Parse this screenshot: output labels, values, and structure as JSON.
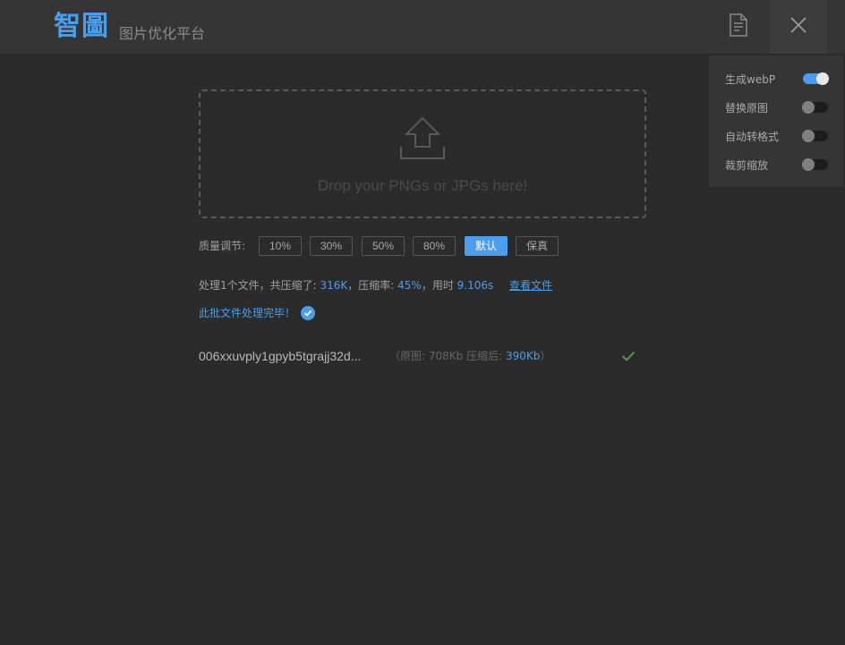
{
  "header": {
    "logo": "智圖",
    "subtitle": "图片优化平台",
    "doc_icon": "document-icon",
    "close_icon": "close-icon"
  },
  "settings": [
    {
      "label": "生成webP",
      "on": true
    },
    {
      "label": "替换原图",
      "on": false
    },
    {
      "label": "自动转格式",
      "on": false
    },
    {
      "label": "裁剪缩放",
      "on": false
    }
  ],
  "dropzone": {
    "icon": "upload-icon",
    "text": "Drop your PNGs or JPGs here!"
  },
  "quality": {
    "label": "质量调节:",
    "options": [
      "10%",
      "30%",
      "50%",
      "80%",
      "默认",
      "保真"
    ],
    "selected": "默认"
  },
  "summary": {
    "prefix": "处理1个文件，共压缩了: ",
    "saved": "316K",
    "ratio_label": "，压缩率: ",
    "ratio": "45%",
    "time_label": "，用时 ",
    "time": "9.106s",
    "view_files": "查看文件"
  },
  "done_message": "此批文件处理完毕！",
  "files": [
    {
      "name": "006xxuvply1gpyb5tgrajj32d...",
      "original_label": "（原图: ",
      "original_size": "708Kb",
      "compressed_label": "  压缩后: ",
      "compressed_size": "390Kb",
      "close_paren": "）",
      "status_icon": "check-icon"
    }
  ],
  "colors": {
    "accent": "#4a9eea",
    "background": "#2b2b2b",
    "header": "#353535",
    "success": "#5a9a4a"
  }
}
